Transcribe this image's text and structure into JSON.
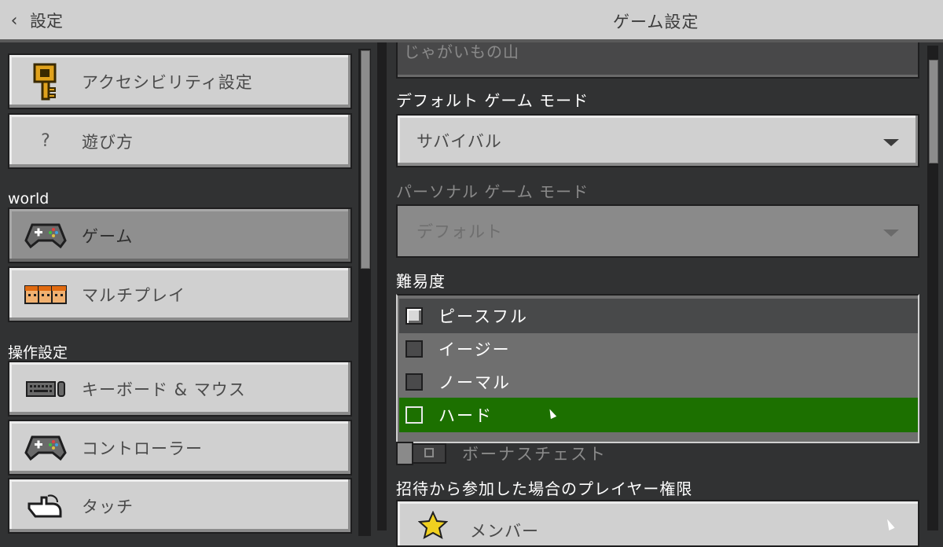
{
  "header": {
    "back_label": "設定",
    "title": "ゲーム設定"
  },
  "sidebar": {
    "items_top": [
      {
        "label": "アクセシビリティ設定",
        "icon": "key-icon"
      },
      {
        "label": "遊び方",
        "icon": "question-icon"
      }
    ],
    "section_world": "world",
    "items_world": [
      {
        "label": "ゲーム",
        "icon": "gamepad-icon",
        "active": true
      },
      {
        "label": "マルチプレイ",
        "icon": "players-icon"
      }
    ],
    "section_controls": "操作設定",
    "items_controls": [
      {
        "label": "キーボード & マウス",
        "icon": "keyboard-icon"
      },
      {
        "label": "コントローラー",
        "icon": "controller-icon"
      },
      {
        "label": "タッチ",
        "icon": "touch-icon"
      }
    ]
  },
  "main": {
    "world_name_value": "じゃがいもの山",
    "default_mode": {
      "label": "デフォルト ゲーム モード",
      "value": "サバイバル"
    },
    "personal_mode": {
      "label": "パーソナル ゲーム モード",
      "value": "デフォルト"
    },
    "difficulty": {
      "label": "難易度",
      "options": [
        "ピースフル",
        "イージー",
        "ノーマル",
        "ハード"
      ],
      "selected": "ピースフル",
      "hovered": "ハード"
    },
    "bonus_chest_label": "ボーナスチェスト",
    "invite_permission": {
      "label": "招待から参加した場合のプレイヤー権限",
      "value": "メンバー"
    }
  },
  "colors": {
    "hover_green": "#1c7000",
    "panel_bg": "#313233",
    "button_gray": "#d0d0d0"
  }
}
